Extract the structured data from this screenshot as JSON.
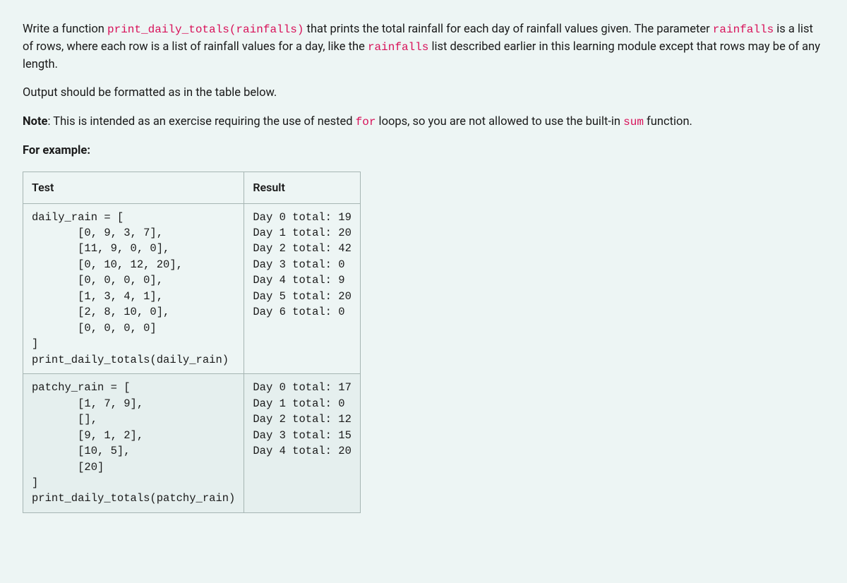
{
  "instructions": {
    "para1_pre": "Write a function ",
    "fn_signature": "print_daily_totals(rainfalls)",
    "para1_mid": " that prints the total rainfall for each day of rainfall values given. The parameter ",
    "param_name": "rainfalls",
    "para1_mid2": " is a list of rows, where each row is a list of rainfall values for a day, like the ",
    "rainfalls_word": "rainfalls",
    "para1_end": " list described earlier in this learning module except that rows may be of any length.",
    "para2": "Output should be formatted as in the table below.",
    "note_label": "Note",
    "note_pre": ": This is intended as an exercise requiring the use of nested ",
    "for_word": "for",
    "note_mid": " loops, so you are not allowed to use the built-in ",
    "sum_word": "sum",
    "note_end": " function.",
    "for_example": "For example:"
  },
  "table": {
    "headers": {
      "test": "Test",
      "result": "Result"
    },
    "rows": [
      {
        "test": "daily_rain = [\n       [0, 9, 3, 7],\n       [11, 9, 0, 0],\n       [0, 10, 12, 20],\n       [0, 0, 0, 0],\n       [1, 3, 4, 1],\n       [2, 8, 10, 0],\n       [0, 0, 0, 0]\n]\nprint_daily_totals(daily_rain)",
        "result": "Day 0 total: 19\nDay 1 total: 20\nDay 2 total: 42\nDay 3 total: 0\nDay 4 total: 9\nDay 5 total: 20\nDay 6 total: 0"
      },
      {
        "test": "patchy_rain = [\n       [1, 7, 9],\n       [],\n       [9, 1, 2],\n       [10, 5],\n       [20]\n]\nprint_daily_totals(patchy_rain)",
        "result": "Day 0 total: 17\nDay 1 total: 0\nDay 2 total: 12\nDay 3 total: 15\nDay 4 total: 20"
      }
    ]
  }
}
